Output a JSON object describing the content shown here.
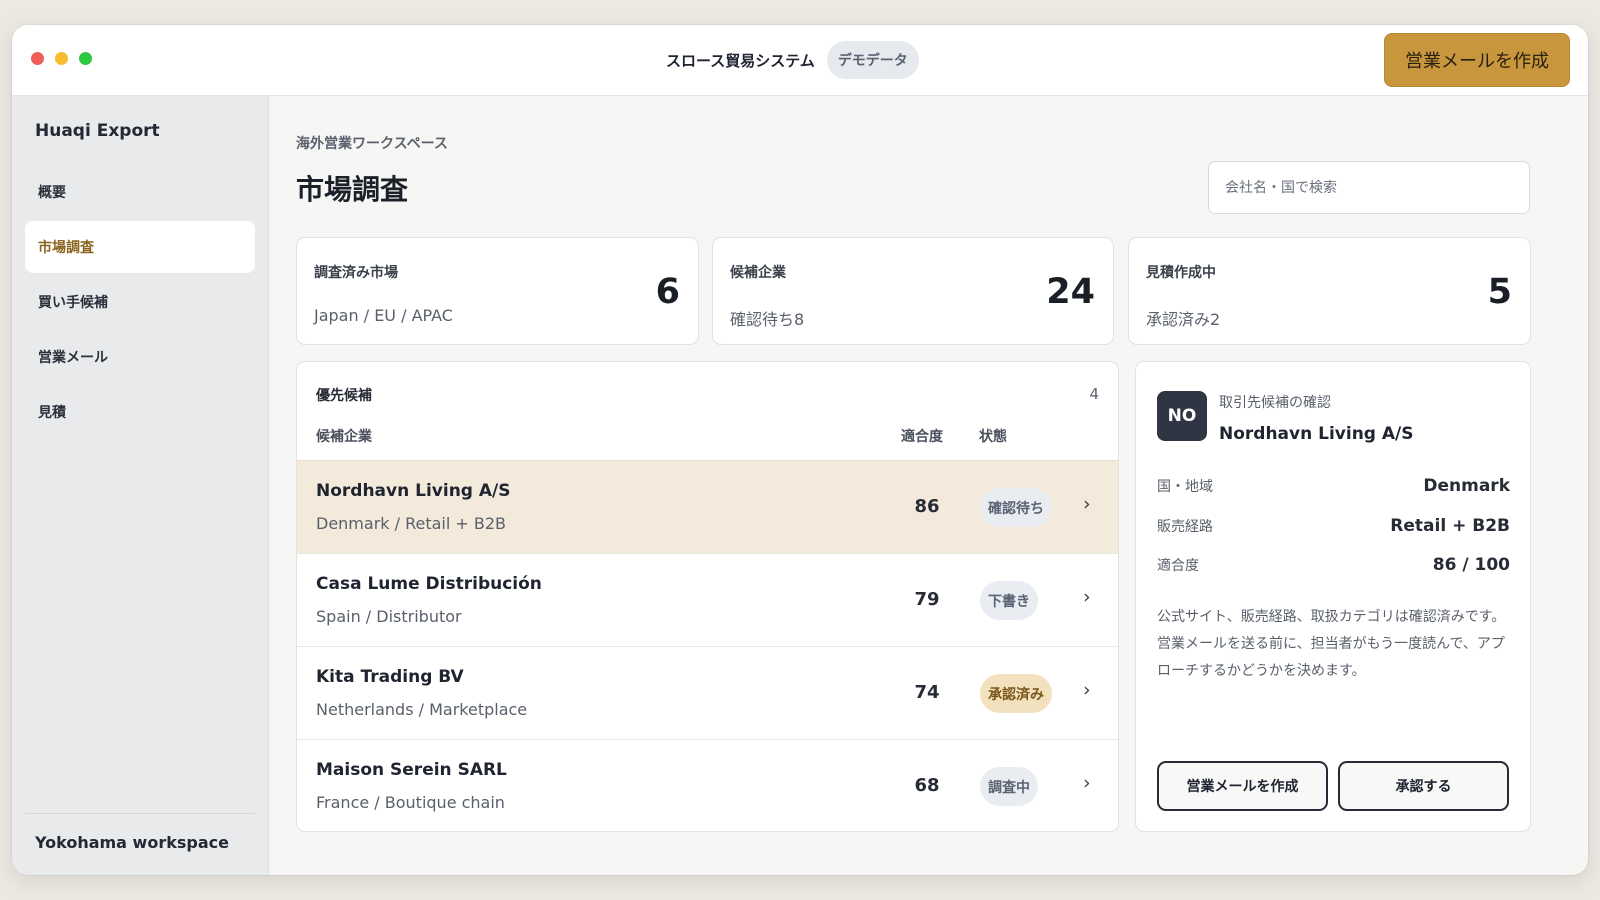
{
  "window": {
    "app_title": "スロース貿易システム",
    "demo_badge": "デモデータ",
    "compose_button": "営業メールを作成"
  },
  "sidebar": {
    "brand": "Huaqi Export",
    "items": [
      {
        "label": "概要",
        "active": false
      },
      {
        "label": "市場調査",
        "active": true
      },
      {
        "label": "買い手候補",
        "active": false
      },
      {
        "label": "営業メール",
        "active": false
      },
      {
        "label": "見積",
        "active": false
      }
    ],
    "workspace": "Yokohama workspace"
  },
  "header": {
    "eyebrow": "海外営業ワークスペース",
    "title": "市場調査",
    "search_placeholder": "会社名・国で検索"
  },
  "stats": [
    {
      "label": "調査済み市場",
      "sub": "Japan / EU / APAC",
      "value": "6"
    },
    {
      "label": "候補企業",
      "sub": "確認待ち8",
      "value": "24"
    },
    {
      "label": "見積作成中",
      "sub": "承認済み2",
      "value": "5"
    }
  ],
  "candidates": {
    "heading": "優先候補",
    "count": "4",
    "columns": {
      "company": "候補企業",
      "score": "適合度",
      "status": "状態"
    },
    "rows": [
      {
        "name": "Nordhavn Living A/S",
        "meta": "Denmark / Retail + B2B",
        "score": "86",
        "status": "確認待ち",
        "selected": true
      },
      {
        "name": "Casa Lume Distribución",
        "meta": "Spain / Distributor",
        "score": "79",
        "status": "下書き",
        "selected": false
      },
      {
        "name": "Kita Trading BV",
        "meta": "Netherlands / Marketplace",
        "score": "74",
        "status": "承認済み",
        "selected": false
      },
      {
        "name": "Maison Serein SARL",
        "meta": "France / Boutique chain",
        "score": "68",
        "status": "調査中",
        "selected": false
      }
    ],
    "chevron": "›"
  },
  "detail": {
    "avatar": "NO",
    "caption": "取引先候補の確認",
    "name": "Nordhavn Living A/S",
    "fields": [
      {
        "key": "国・地域",
        "value": "Denmark"
      },
      {
        "key": "販売経路",
        "value": "Retail + B2B"
      },
      {
        "key": "適合度",
        "value": "86 / 100"
      }
    ],
    "note": "公式サイト、販売経路、取扱カテゴリは確認済みです。営業メールを送る前に、担当者がもう一度読んで、アプローチするかどうかを決めます。",
    "compose_button": "営業メールを作成",
    "approve_button": "承認する"
  },
  "colors": {
    "accent": "#c8963d",
    "selected_row": "#f3eadb",
    "approved_badge": "#f1e1bf"
  }
}
